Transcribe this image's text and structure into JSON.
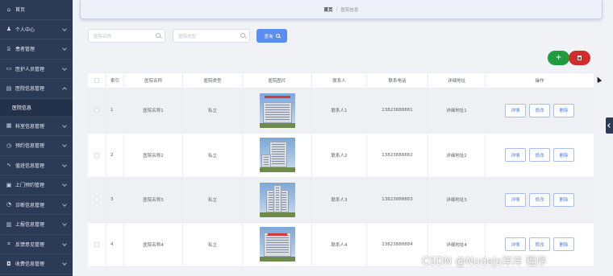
{
  "sidebar": {
    "items": [
      {
        "label": "首页",
        "icon": "home-icon"
      },
      {
        "label": "个人中心",
        "icon": "user-icon"
      },
      {
        "label": "患者管理",
        "icon": "bank-icon"
      },
      {
        "label": "医护人员管理",
        "icon": "ticket-icon"
      },
      {
        "label": "医院信息管理",
        "icon": "document-icon",
        "submenu": [
          "医院信息"
        ]
      },
      {
        "label": "科室信息管理",
        "icon": "folder-icon"
      },
      {
        "label": "预约信息管理",
        "icon": "clock-icon"
      },
      {
        "label": "值班信息管理",
        "icon": "pulse-icon"
      },
      {
        "label": "上门预约管理",
        "icon": "calendar-icon"
      },
      {
        "label": "诊断信息管理",
        "icon": "chart-icon"
      },
      {
        "label": "上报信息管理",
        "icon": "clipboard-icon"
      },
      {
        "label": "反馈意见管理",
        "icon": "message-icon"
      },
      {
        "label": "收费信息管理",
        "icon": "wallet-icon"
      }
    ]
  },
  "breadcrumb": {
    "home": "首页",
    "separator": "/",
    "current": "医院信息"
  },
  "search": {
    "name_placeholder": "医院名称",
    "type_placeholder": "医院类型",
    "button_label": "查询"
  },
  "actions": {
    "add_label": "+"
  },
  "table": {
    "headers": [
      "索引",
      "医院名称",
      "医院类型",
      "医院图片",
      "联系人",
      "联系电话",
      "详细地址",
      "操作"
    ],
    "rows": [
      {
        "index": "1",
        "name": "医院名称1",
        "type": "私立",
        "contact": "联系人1",
        "phone": "13823888881",
        "address": "详细地址1"
      },
      {
        "index": "2",
        "name": "医院名称2",
        "type": "私立",
        "contact": "联系人2",
        "phone": "13823888882",
        "address": "详细地址2"
      },
      {
        "index": "3",
        "name": "医院名称3",
        "type": "私立",
        "contact": "联系人3",
        "phone": "13823888883",
        "address": "详细地址3"
      },
      {
        "index": "4",
        "name": "医院名称4",
        "type": "私立",
        "contact": "联系人4",
        "phone": "13823888884",
        "address": "详细地址4"
      }
    ],
    "op_labels": {
      "detail": "详情",
      "edit": "修改",
      "delete": "删除"
    }
  },
  "watermark": "CSDN @Nodejs洋洋  程序",
  "colors": {
    "sidebar": "#2b3a55",
    "primary": "#5b8cf2",
    "add": "#1e9c3e",
    "danger": "#d12b2b"
  }
}
